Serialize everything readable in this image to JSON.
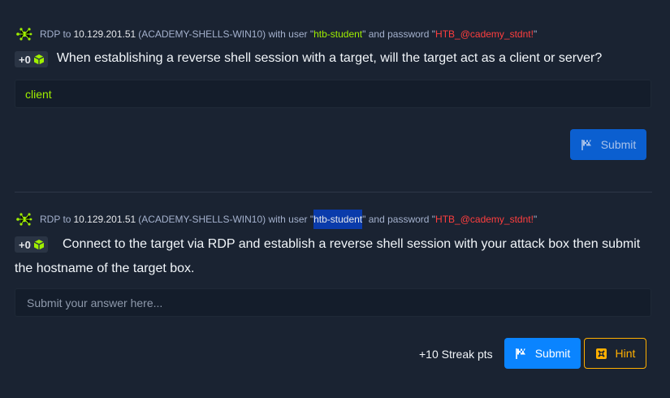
{
  "questions": [
    {
      "rdp": {
        "prefix": "RDP to",
        "ip": "10.129.201.51",
        "host": "(ACADEMY-SHELLS-WIN10) with user \"",
        "user": "htb-student",
        "mid": "\" and password \"",
        "password": "HTB_@cademy_stdnt!",
        "end": "\""
      },
      "points": "+0",
      "text": "When establishing a reverse shell session with a target, will the target act as a client or server?",
      "answer_value": "client",
      "submit_label": "Submit"
    },
    {
      "rdp": {
        "prefix": "RDP to",
        "ip": "10.129.201.51",
        "host": "(ACADEMY-SHELLS-WIN10) with user \"",
        "user": "htb-student",
        "mid": "\" and password \"",
        "password": "HTB_@cademy_stdnt!",
        "end": "\""
      },
      "points": "+0",
      "text": "Connect to the target via RDP and establish a reverse shell session with your attack box then submit the hostname of the target box.",
      "answer_placeholder": "Submit your answer here...",
      "streak": "+10 Streak pts",
      "submit_label": "Submit",
      "hint_label": "Hint"
    }
  ],
  "colors": {
    "background": "#1a2332",
    "accent_green": "#9fef00",
    "password_red": "#ff3e3e",
    "submit_blue": "#0a84ff",
    "hint_orange": "#ffaf00",
    "selection": "#0a3bab"
  },
  "icons": [
    "network-node-icon",
    "cube-icon",
    "flag-icon",
    "hint-icon"
  ]
}
